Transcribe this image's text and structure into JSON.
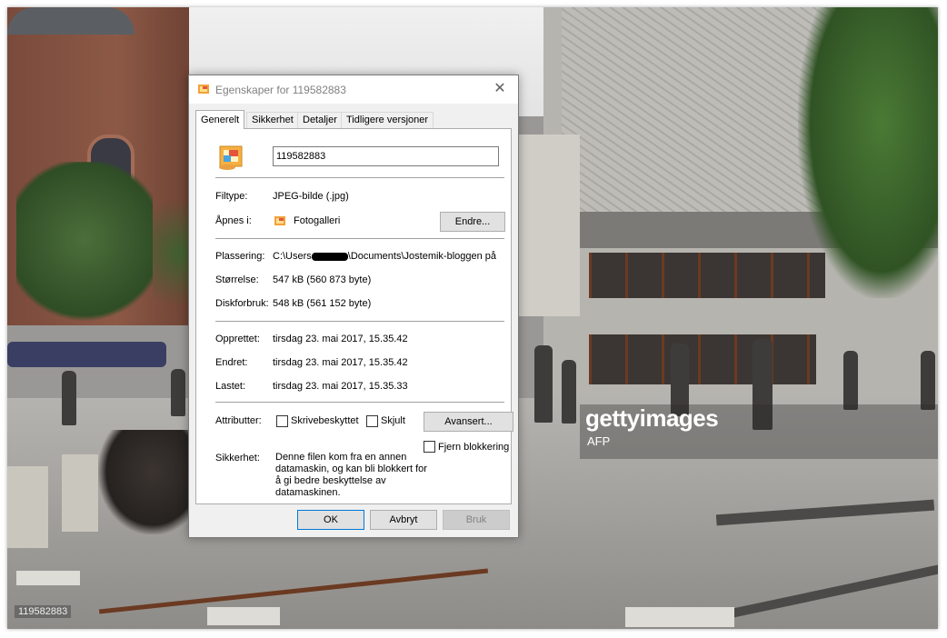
{
  "background": {
    "watermark_brand": "gettyimages",
    "watermark_credit": "AFP",
    "photo_id": "119582883"
  },
  "dialog": {
    "title": "Egenskaper for 119582883",
    "tabs": [
      {
        "label": "Generelt",
        "active": true
      },
      {
        "label": "Sikkerhet",
        "active": false
      },
      {
        "label": "Detaljer",
        "active": false
      },
      {
        "label": "Tidligere versjoner",
        "active": false
      }
    ],
    "file_name": "119582883",
    "filetype": {
      "label": "Filtype:",
      "value": "JPEG-bilde (.jpg)"
    },
    "opens_with": {
      "label": "Åpnes i:",
      "value": "Fotogalleri",
      "change_button": "Endre..."
    },
    "location": {
      "label": "Plassering:",
      "value_prefix": "C:\\Users",
      "value_suffix": "\\Documents\\Jostemik-bloggen på G"
    },
    "size": {
      "label": "Størrelse:",
      "value": "547 kB (560 873 byte)"
    },
    "disk_usage": {
      "label": "Diskforbruk:",
      "value": "548 kB (561 152 byte)"
    },
    "created": {
      "label": "Opprettet:",
      "value": "tirsdag 23. mai 2017, 15.35.42"
    },
    "modified": {
      "label": "Endret:",
      "value": "tirsdag 23. mai 2017, 15.35.42"
    },
    "accessed": {
      "label": "Lastet:",
      "value": "tirsdag 23. mai 2017, 15.35.33"
    },
    "attributes": {
      "label": "Attributter:",
      "readonly": "Skrivebeskyttet",
      "hidden": "Skjult",
      "advanced_button": "Avansert..."
    },
    "security": {
      "label": "Sikkerhet:",
      "text": "Denne filen kom fra en annen datamaskin, og kan bli blokkert for å gi bedre beskyttelse av datamaskinen.",
      "unblock": "Fjern blokkering"
    },
    "buttons": {
      "ok": "OK",
      "cancel": "Avbryt",
      "apply": "Bruk"
    }
  }
}
